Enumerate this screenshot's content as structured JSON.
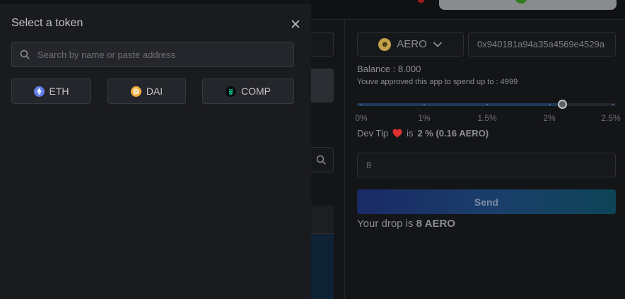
{
  "modal": {
    "title": "Select a token",
    "close_label": "×",
    "search_placeholder": "Search by name or paste address",
    "tokens": [
      {
        "symbol": "ETH",
        "icon": "eth-icon",
        "color": "#627eea"
      },
      {
        "symbol": "DAI",
        "icon": "dai-icon",
        "color": "#f5ac37"
      },
      {
        "symbol": "COMP",
        "icon": "comp-icon",
        "color": "#00d395"
      }
    ]
  },
  "drop": {
    "token": {
      "symbol": "AERO",
      "icon": "aero-icon"
    },
    "address": "0x940181a94a35a4569e4529a",
    "balance": "Balance : 8.000",
    "approved": "Youve approved this app to spend up to : 4999",
    "tip_slider": {
      "value_percent": 2,
      "max_percent": 2.5,
      "marks": [
        "0%",
        "1%",
        "1.5%",
        "2%",
        "2.5%"
      ]
    },
    "dev_tip": {
      "prefix": "Dev Tip",
      "middle": "is",
      "value": "2 % (0.16 AERO)"
    },
    "amount_value": "8",
    "send_label": "Send",
    "summary": {
      "prefix": "Your drop is",
      "value": "8 AERO"
    }
  },
  "colors": {
    "accent_send_start": "#1a2a66",
    "accent_send_end": "#0d4457",
    "heart": "#e03131",
    "slider_fill": "#1d3a5b"
  }
}
